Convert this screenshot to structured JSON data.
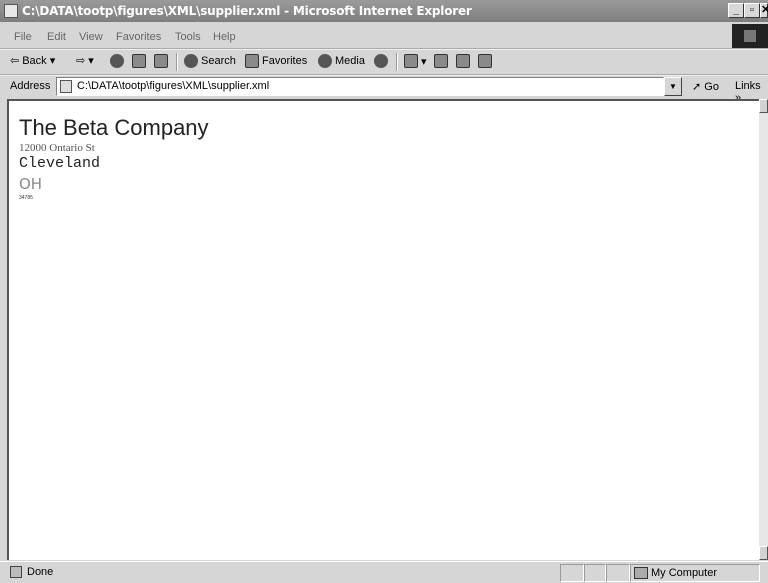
{
  "window": {
    "title": "C:\\DATA\\tootp\\figures\\XML\\supplier.xml - Microsoft Internet Explorer",
    "min_label": "_",
    "max_label": "▫",
    "close_label": "✕"
  },
  "menu": [
    "File",
    "Edit",
    "View",
    "Favorites",
    "Tools",
    "Help"
  ],
  "toolbar": {
    "back_label": "Back",
    "search_label": "Search",
    "favorites_label": "Favorites",
    "media_label": "Media"
  },
  "address": {
    "label": "Address",
    "value": "C:\\DATA\\tootp\\figures\\XML\\supplier.xml",
    "go_label": "Go",
    "links_label": "Links"
  },
  "document": {
    "company": "The Beta Company",
    "street": "12000 Ontario St",
    "city": "Cleveland",
    "state": "OH",
    "zip": "34785"
  },
  "status": {
    "text": "Done",
    "zone": "My Computer"
  }
}
